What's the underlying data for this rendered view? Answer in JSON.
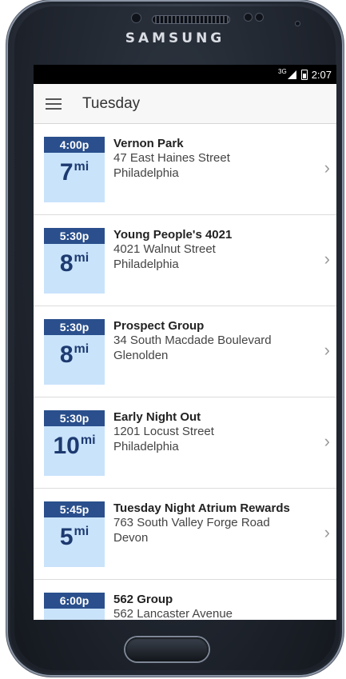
{
  "device": {
    "brand": "SAMSUNG"
  },
  "status_bar": {
    "network": "3G",
    "time": "2:07"
  },
  "app_bar": {
    "title": "Tuesday"
  },
  "meetings": [
    {
      "time": "4:00p",
      "distance": "7",
      "unit": "mi",
      "name": "Vernon Park",
      "address": "47 East Haines Street",
      "city": "Philadelphia"
    },
    {
      "time": "5:30p",
      "distance": "8",
      "unit": "mi",
      "name": "Young People's 4021",
      "address": "4021 Walnut Street",
      "city": "Philadelphia"
    },
    {
      "time": "5:30p",
      "distance": "8",
      "unit": "mi",
      "name": "Prospect Group",
      "address": "34 South Macdade Boulevard",
      "city": "Glenolden"
    },
    {
      "time": "5:30p",
      "distance": "10",
      "unit": "mi",
      "name": "Early Night Out",
      "address": "1201 Locust Street",
      "city": "Philadelphia"
    },
    {
      "time": "5:45p",
      "distance": "5",
      "unit": "mi",
      "name": "Tuesday Night Atrium Rewards",
      "address": "763 South Valley Forge Road",
      "city": "Devon"
    },
    {
      "time": "6:00p",
      "distance": "",
      "unit": "",
      "name": "562 Group",
      "address": "562 Lancaster Avenue",
      "city": ""
    }
  ],
  "icons": {
    "menu": "hamburger-menu-icon",
    "chevron": "chevron-right-icon",
    "signal": "signal-icon",
    "battery": "battery-icon"
  },
  "colors": {
    "time_badge": "#2a4f8c",
    "distance_badge": "#c9e3fb",
    "distance_text": "#1d3a70"
  }
}
